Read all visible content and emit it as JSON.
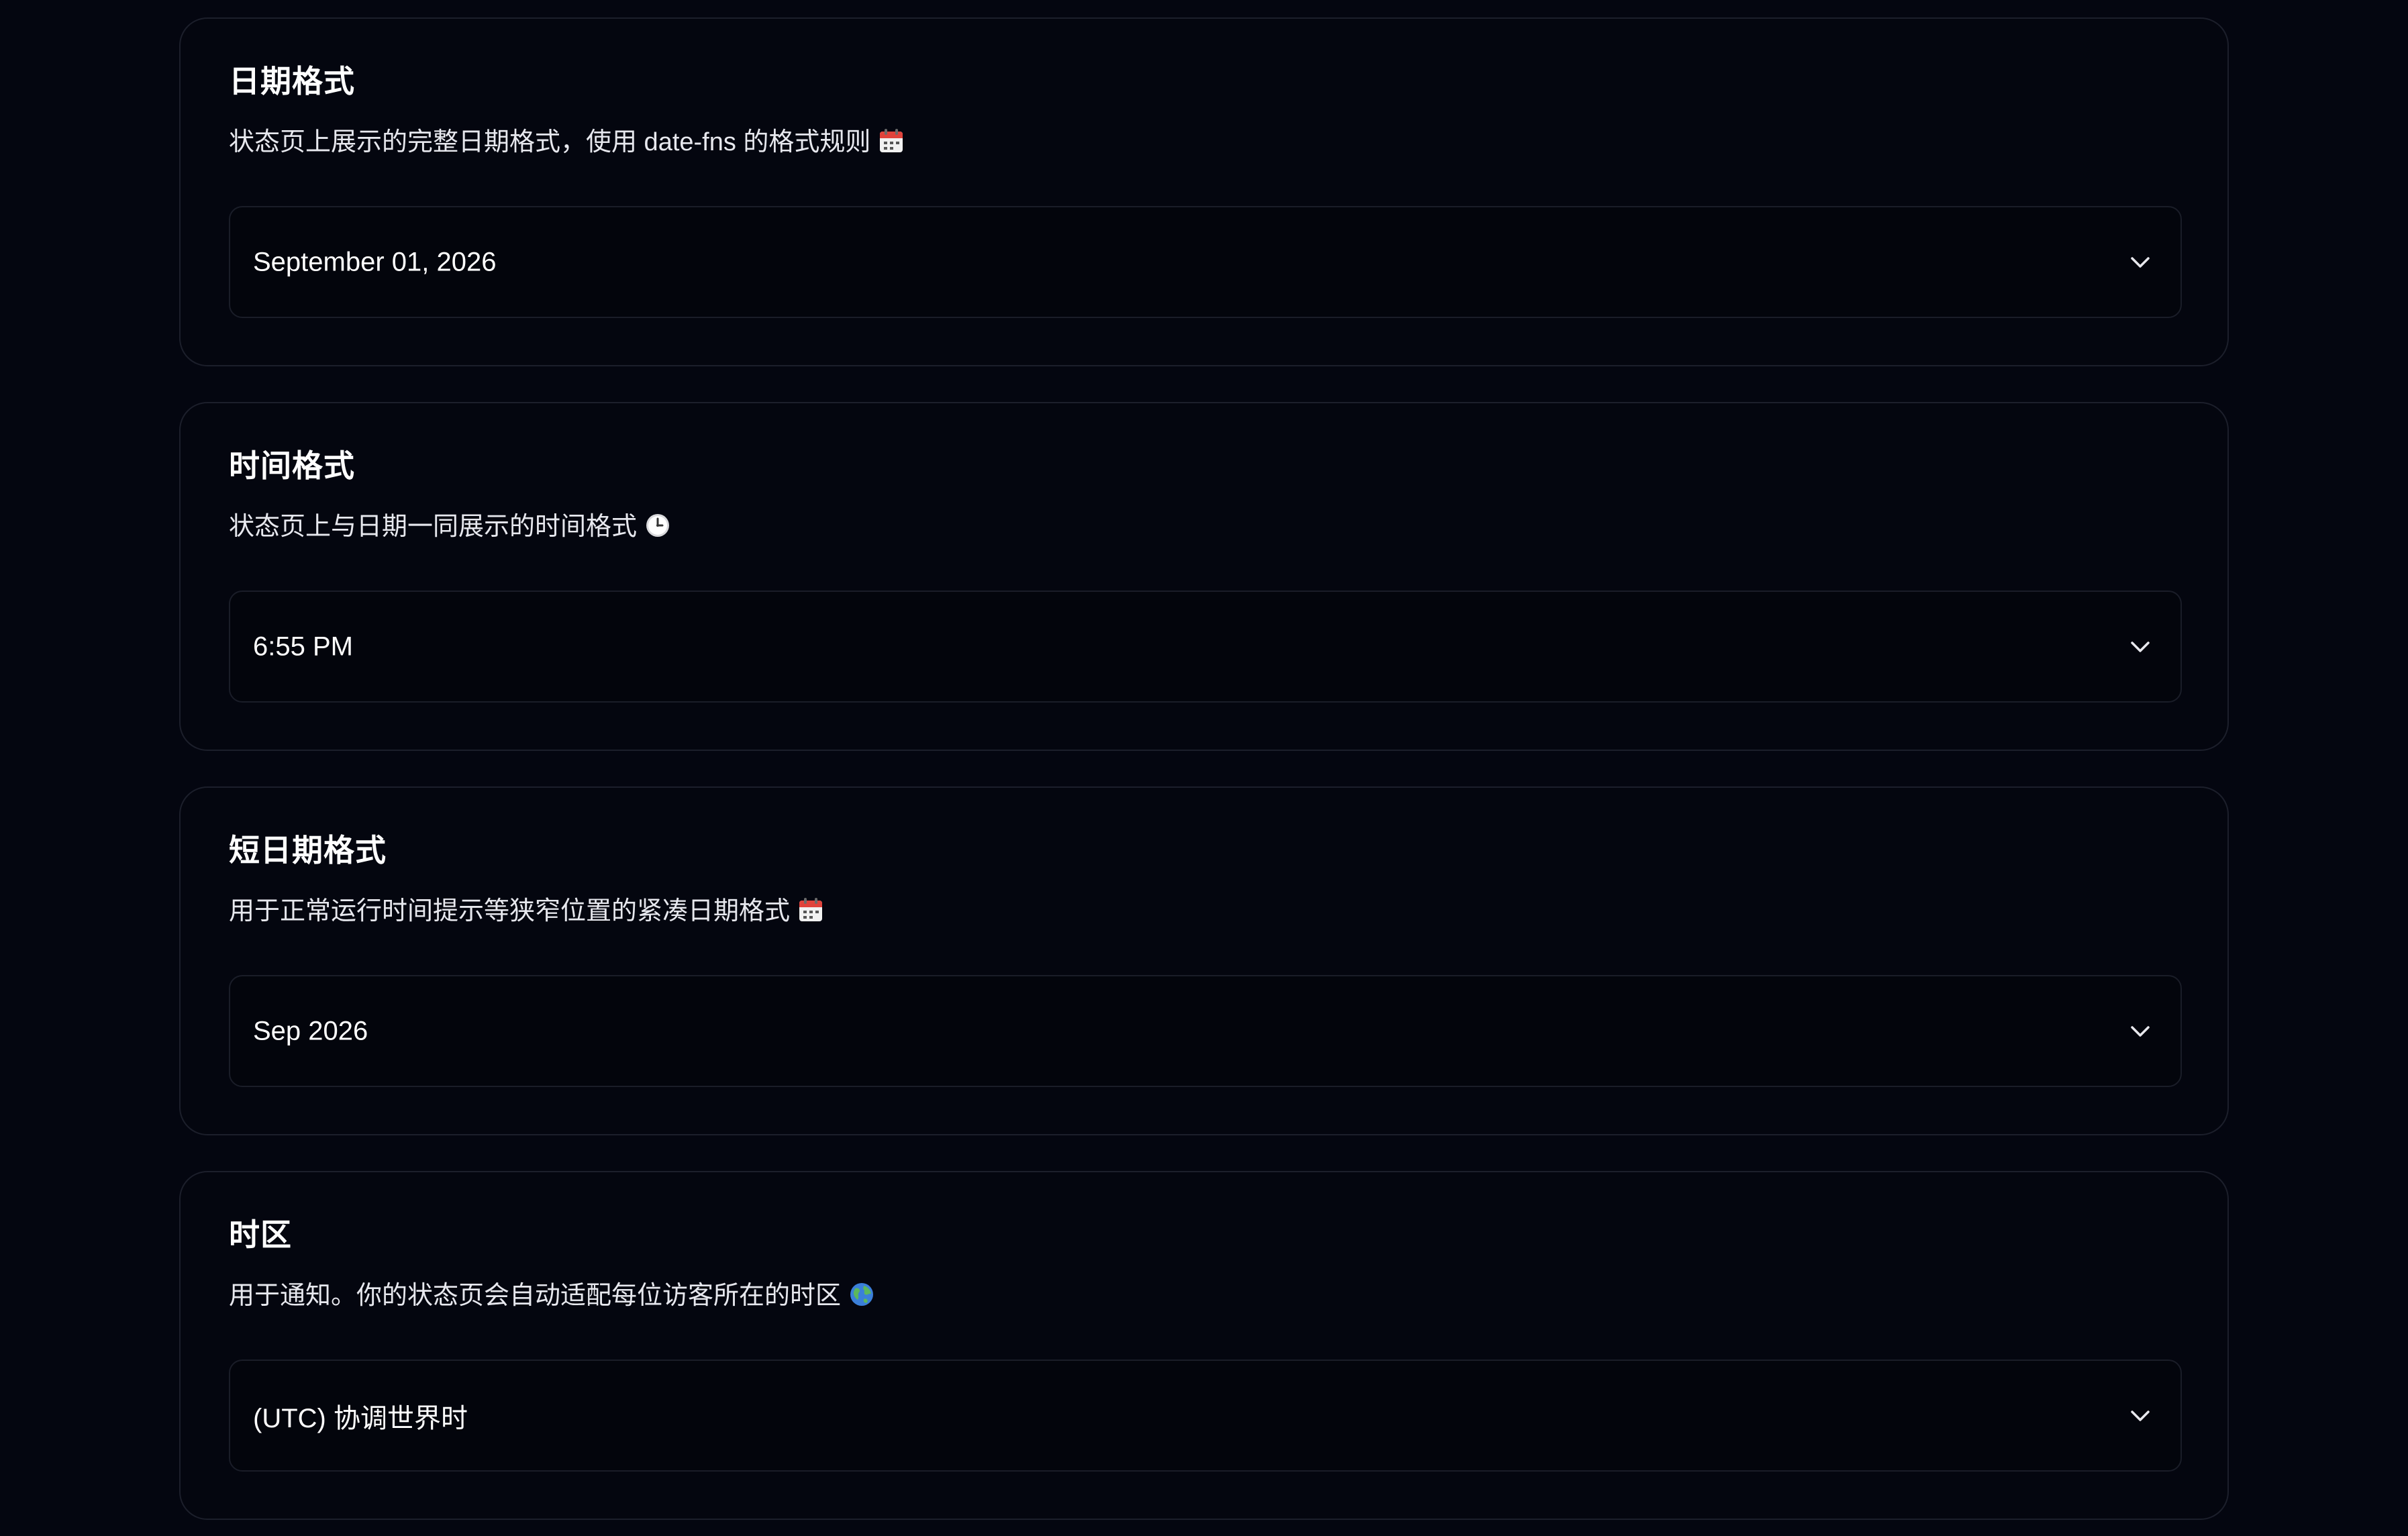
{
  "sections": [
    {
      "title": "日期格式",
      "description": "状态页上展示的完整日期格式，使用 date-fns 的格式规则",
      "icon": "calendar-icon",
      "selected_value": "September 01, 2026"
    },
    {
      "title": "时间格式",
      "description": "状态页上与日期一同展示的时间格式",
      "icon": "clock-icon",
      "selected_value": "6:55 PM"
    },
    {
      "title": "短日期格式",
      "description": "用于正常运行时间提示等狭窄位置的紧凑日期格式",
      "icon": "calendar-icon",
      "selected_value": "Sep 2026"
    },
    {
      "title": "时区",
      "description": "用于通知。你的状态页会自动适配每位访客所在的时区",
      "icon": "globe-icon",
      "selected_value": "(UTC) 协调世界时"
    }
  ],
  "colors": {
    "background": "#040610",
    "card_border": "#1c1f2b",
    "text_primary": "#ffffff",
    "text_secondary": "#e7e8ee"
  }
}
